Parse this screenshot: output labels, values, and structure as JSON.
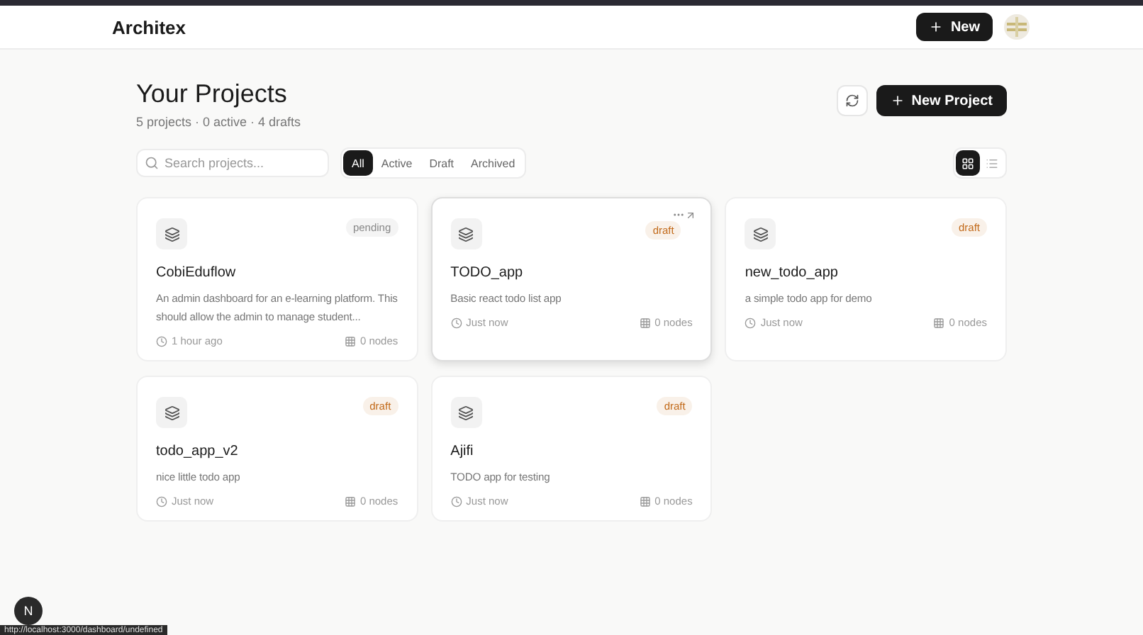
{
  "header": {
    "brand": "Architex",
    "new_button": "New"
  },
  "page": {
    "title": "Your Projects",
    "summary": "5 projects · 0 active · 4 drafts",
    "new_project_button": "New Project"
  },
  "search": {
    "placeholder": "Search projects..."
  },
  "filters": [
    {
      "label": "All",
      "selected": true
    },
    {
      "label": "Active",
      "selected": false
    },
    {
      "label": "Draft",
      "selected": false
    },
    {
      "label": "Archived",
      "selected": false
    }
  ],
  "view_modes": [
    {
      "kind": "grid",
      "selected": true
    },
    {
      "kind": "list",
      "selected": false
    }
  ],
  "projects": [
    {
      "name": "CobiEduflow",
      "description": "An admin dashboard for an e-learning platform. This should allow the admin to manage student...",
      "status": "pending",
      "color": "#888888",
      "time": "1 hour ago",
      "nodes": "0 nodes",
      "hovered": false
    },
    {
      "name": "TODO_app",
      "description": "Basic react todo list app",
      "status": "draft",
      "color": "#c26a1a",
      "time": "Just now",
      "nodes": "0 nodes",
      "hovered": true
    },
    {
      "name": "new_todo_app",
      "description": "a simple todo app for demo",
      "status": "draft",
      "color": "#c26a1a",
      "time": "Just now",
      "nodes": "0 nodes",
      "hovered": false
    },
    {
      "name": "todo_app_v2",
      "description": "nice little todo app",
      "status": "draft",
      "color": "#c26a1a",
      "time": "Just now",
      "nodes": "0 nodes",
      "hovered": false
    },
    {
      "name": "Ajifi",
      "description": "TODO app for testing",
      "status": "draft",
      "color": "#c26a1a",
      "time": "Just now",
      "nodes": "0 nodes",
      "hovered": false
    }
  ],
  "dev_badge": "N",
  "status_url": "http://localhost:3000/dashboard/undefined"
}
